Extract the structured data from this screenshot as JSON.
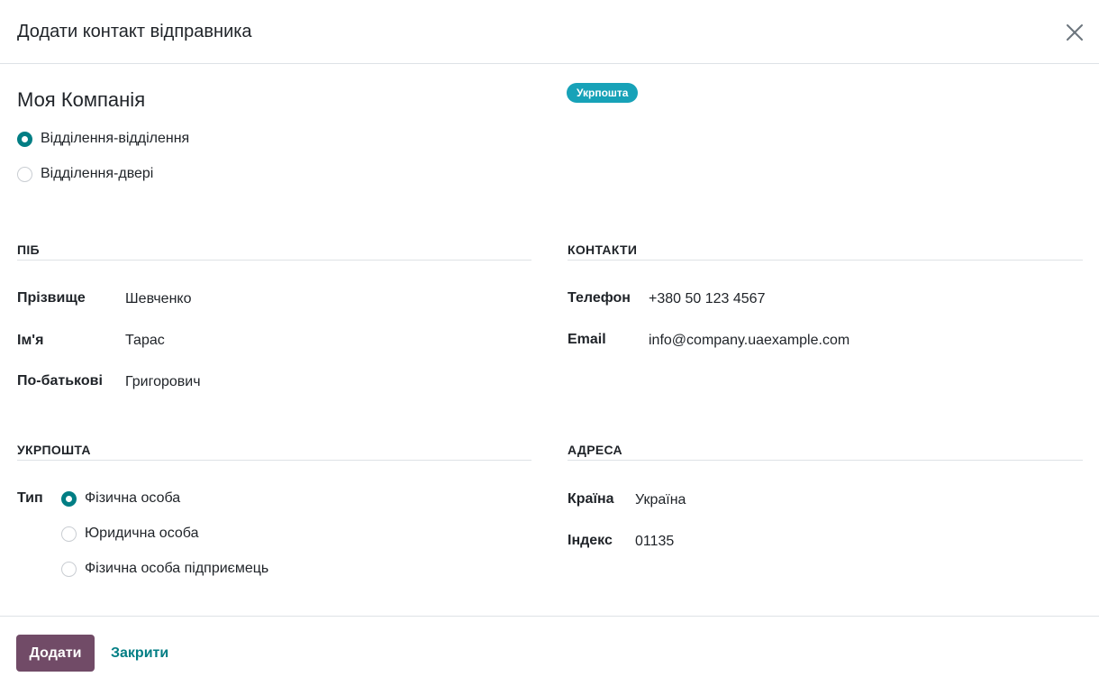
{
  "dialog": {
    "title": "Додати контакт відправника",
    "close_icon": "close-icon"
  },
  "company": {
    "name": "Моя Компанія",
    "badge": "Укрпошта",
    "badge_color": "#17a2b8",
    "delivery_options": [
      {
        "label": "Відділення-відділення",
        "checked": true
      },
      {
        "label": "Відділення-двері",
        "checked": false
      }
    ]
  },
  "sections": {
    "name": {
      "title": "ПІБ",
      "fields": [
        {
          "label": "Прізвище",
          "value": "Шевченко"
        },
        {
          "label": "Ім'я",
          "value": "Тарас"
        },
        {
          "label": "По-батькові",
          "value": "Григорович"
        }
      ]
    },
    "contacts": {
      "title": "КОНТАКТИ",
      "fields": [
        {
          "label": "Телефон",
          "value": "+380 50 123 4567"
        },
        {
          "label": "Email",
          "value": "info@company.uaexample.com"
        }
      ]
    },
    "ukrposhta": {
      "title": "УКРПОШТА",
      "type_label": "Тип",
      "type_options": [
        {
          "label": "Фізична особа",
          "checked": true
        },
        {
          "label": "Юридична особа",
          "checked": false
        },
        {
          "label": "Фізична особа підприємець",
          "checked": false
        }
      ]
    },
    "address": {
      "title": "АДРЕСА",
      "fields": [
        {
          "label": "Країна",
          "value": "Україна"
        },
        {
          "label": "Індекс",
          "value": "01135"
        }
      ]
    }
  },
  "footer": {
    "add_label": "Додати",
    "close_label": "Закрити"
  },
  "colors": {
    "accent": "#017e84",
    "primary_button": "#714b67",
    "divider": "#dee2e6"
  }
}
